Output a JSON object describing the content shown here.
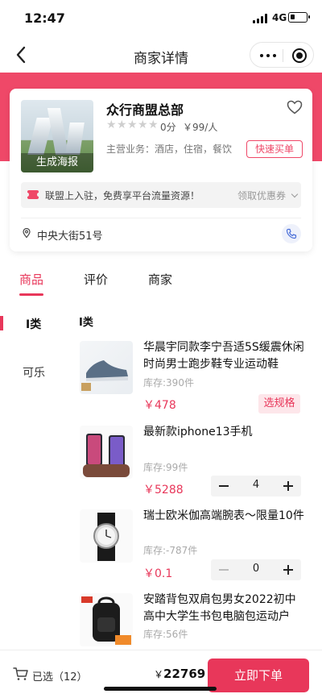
{
  "status": {
    "time": "12:47",
    "network": "4G"
  },
  "nav": {
    "title": "商家详情"
  },
  "merchant": {
    "poster_label": "生成海报",
    "name": "众行商盟总部",
    "score": "0分",
    "per_person": "￥99/人",
    "business": "主营业务：酒店，住宿，餐饮",
    "quick_buy": "快速买单",
    "promo": "联盟上入驻，免费享平台流量资源！",
    "coupon": "领取优惠券",
    "address": "中央大街51号",
    "rating_stars": 0
  },
  "tabs": [
    {
      "label": "商品"
    },
    {
      "label": "评价"
    },
    {
      "label": "商家"
    }
  ],
  "categories": [
    {
      "label": "I类"
    },
    {
      "label": "可乐"
    }
  ],
  "section_title": "I类",
  "products": [
    {
      "name": "华晨宇同款李宁吾适5S缓震休闲时尚男士跑步鞋专业运动鞋",
      "stock": "库存:390件",
      "price": "￥478",
      "action": "选规格"
    },
    {
      "name": "最新款iphone13手机",
      "stock": "库存:99件",
      "price": "￥5288",
      "qty": "4"
    },
    {
      "name": "瑞士欧米伽高端腕表～限量10件",
      "stock": "库存:-787件",
      "price": "￥0.1",
      "qty": "0"
    },
    {
      "name": "安踏背包双肩包男女2022初中高中大学生书包电脑包运动户",
      "stock": "库存:56件"
    }
  ],
  "bottom": {
    "selected": "已选（12）",
    "currency": "￥",
    "total": "22769",
    "order": "立即下单"
  },
  "colors": {
    "accent": "#e8375a",
    "band": "#ef4868"
  }
}
